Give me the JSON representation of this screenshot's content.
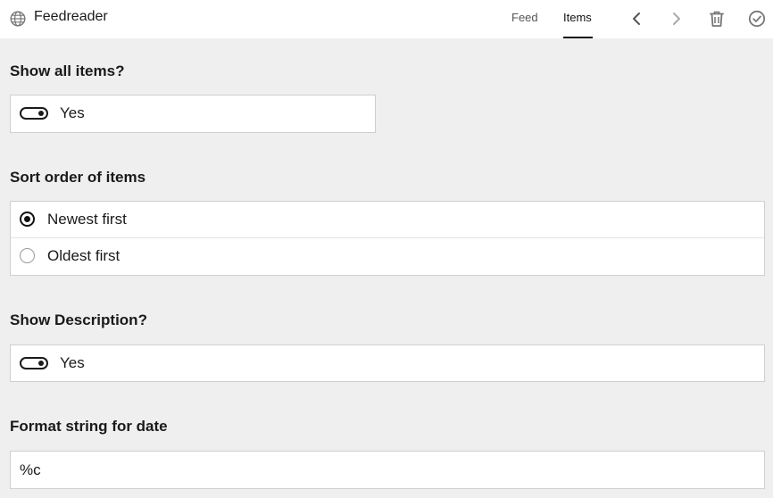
{
  "header": {
    "app_title": "Feedreader",
    "app_icon": "globe-icon",
    "tabs": [
      {
        "label": "Feed",
        "active": false
      },
      {
        "label": "Items",
        "active": true
      }
    ],
    "toolbar_icons": [
      "chevron-left-icon",
      "chevron-right-icon",
      "trash-icon",
      "check-circle-icon"
    ]
  },
  "form": {
    "show_all_items": {
      "label": "Show all items?",
      "value_label": "Yes",
      "on": true
    },
    "sort_order": {
      "label": "Sort order of items",
      "options": [
        {
          "label": "Newest first",
          "selected": true
        },
        {
          "label": "Oldest first",
          "selected": false
        }
      ]
    },
    "show_description": {
      "label": "Show Description?",
      "value_label": "Yes",
      "on": true
    },
    "date_format": {
      "label": "Format string for date",
      "value": "%c"
    }
  },
  "colors": {
    "background": "#efefef",
    "surface": "#ffffff",
    "border": "#cfcfcf",
    "text": "#1a1a1a",
    "muted": "#555555"
  }
}
